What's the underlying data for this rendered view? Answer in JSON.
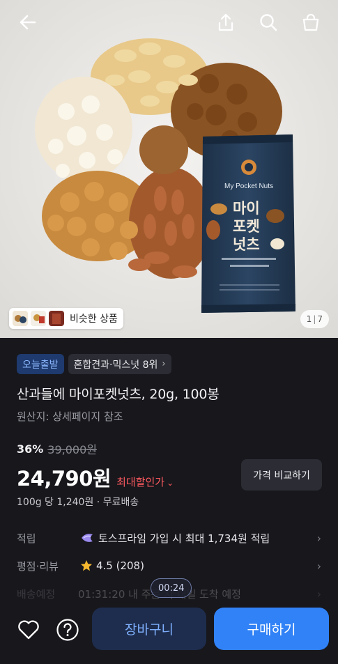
{
  "header": {
    "back_icon": "arrow-left-icon",
    "share_icon": "share-icon",
    "search_icon": "search-icon",
    "cart_icon": "shopping-bag-icon"
  },
  "hero": {
    "package": {
      "en_name": "My Pocket Nuts",
      "kr_line1": "마이",
      "kr_line2": "포켓",
      "kr_line3": "넛츠"
    },
    "similar_label": "비슷한 상품",
    "pager_current": "1",
    "pager_total": "7"
  },
  "product": {
    "badge_today": "오늘출발",
    "badge_rank": "혼합견과·믹스넛 8위",
    "title": "산과들에 마이포켓넛츠, 20g, 100봉",
    "origin": "원산지: 상세페이지 참조",
    "discount_rate": "36%",
    "original_price": "39,000원",
    "price": "24,790원",
    "max_discount": "최대할인가",
    "compare_button": "가격 비교하기",
    "unit_price": "100g 당 1,240원 · 무료배송"
  },
  "info_rows": {
    "points_label": "적립",
    "points_value": "토스프라임 가입 시 최대 1,734원 적립",
    "rating_label": "평점·리뷰",
    "rating_value": "4.5 (208)",
    "delivery_label": "배송예정",
    "delivery_value": "01:31:20 내 주문 시 내일 도착 예정"
  },
  "bottom": {
    "timer": "00:24",
    "cart_button": "장바구니",
    "buy_button": "구매하기"
  },
  "colors": {
    "background": "#17171c",
    "accent_blue": "#3182f6",
    "discount_red": "#ff5a5f",
    "star": "#f5b82e"
  }
}
